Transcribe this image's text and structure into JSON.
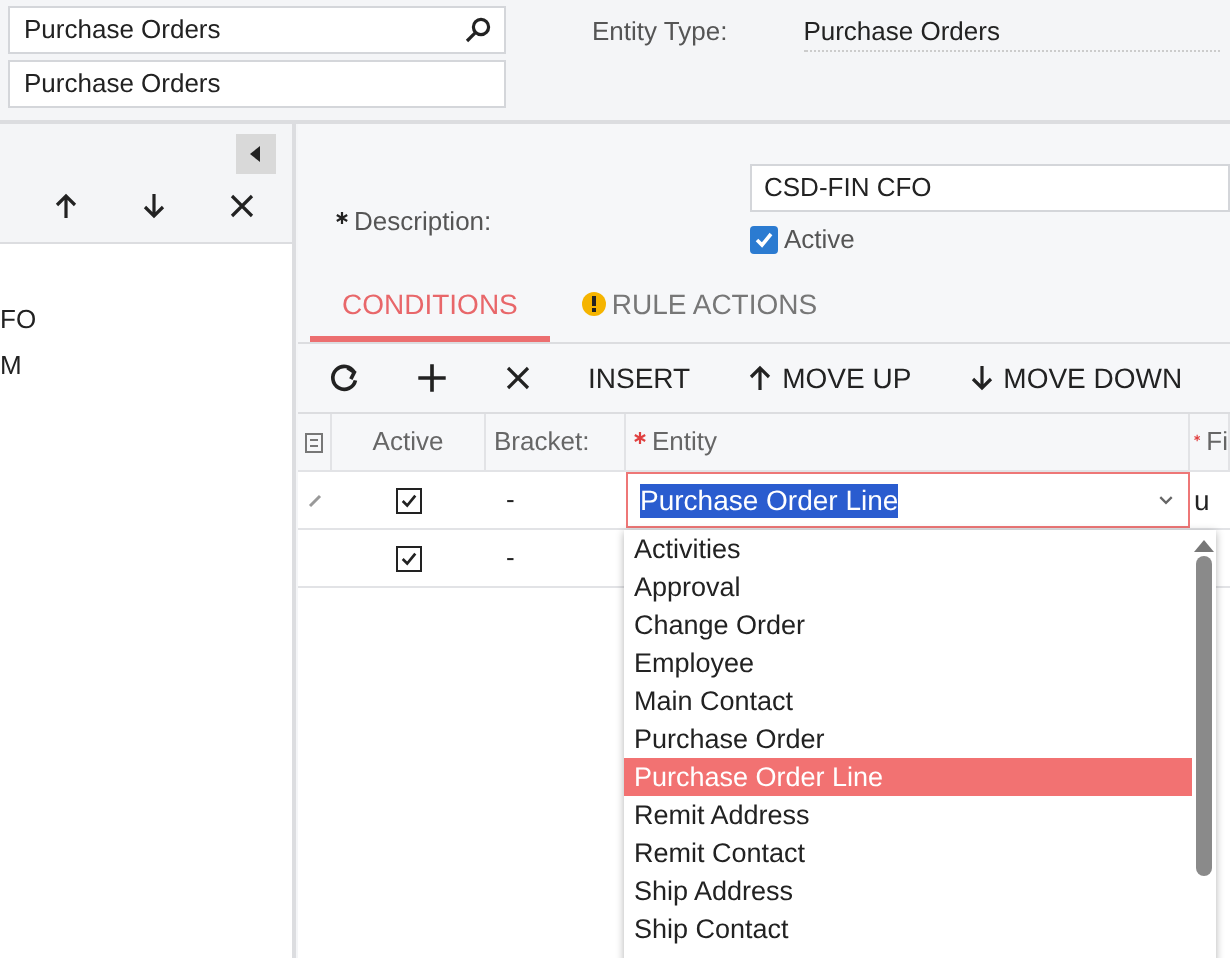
{
  "header": {
    "search_field": {
      "value": "Purchase Orders"
    },
    "name_field": {
      "value": "Purchase Orders"
    },
    "entity_type": {
      "label": "Entity Type:",
      "value": "Purchase Orders"
    }
  },
  "left_panel": {
    "items": [
      {
        "label": "FO"
      },
      {
        "label": "M"
      }
    ]
  },
  "form": {
    "description": {
      "label": "Description:",
      "value": "CSD-FIN CFO"
    },
    "active": {
      "label": "Active",
      "checked": true
    }
  },
  "tabs": [
    {
      "label": "CONDITIONS",
      "selected": true,
      "warning": false
    },
    {
      "label": "RULE ACTIONS",
      "selected": false,
      "warning": true
    }
  ],
  "toolbar": [
    {
      "kind": "refresh"
    },
    {
      "kind": "add"
    },
    {
      "kind": "delete"
    },
    {
      "kind": "text",
      "label": "INSERT"
    },
    {
      "kind": "up",
      "label": "MOVE UP"
    },
    {
      "kind": "down",
      "label": "MOVE DOWN"
    }
  ],
  "table": {
    "columns": [
      {
        "label": "Active",
        "required": false
      },
      {
        "label": "Bracket:",
        "required": false
      },
      {
        "label": "Entity",
        "required": true
      },
      {
        "label": "Fi",
        "required": true
      }
    ],
    "rows": [
      {
        "editing": true,
        "active": true,
        "brackets": "-",
        "entity": "Purchase Order Line",
        "column_4": "u"
      },
      {
        "editing": false,
        "active": true,
        "brackets": "-"
      }
    ]
  },
  "dropdown": {
    "items": [
      {
        "label": "Activities",
        "selected": false
      },
      {
        "label": "Approval",
        "selected": false
      },
      {
        "label": "Change Order",
        "selected": false
      },
      {
        "label": "Employee",
        "selected": false
      },
      {
        "label": "Main Contact",
        "selected": false
      },
      {
        "label": "Purchase Order",
        "selected": false
      },
      {
        "label": "Purchase Order Line",
        "selected": true
      },
      {
        "label": "Remit Address",
        "selected": false
      },
      {
        "label": "Remit Contact",
        "selected": false
      },
      {
        "label": "Ship Address",
        "selected": false
      },
      {
        "label": "Ship Contact",
        "selected": false
      }
    ]
  }
}
